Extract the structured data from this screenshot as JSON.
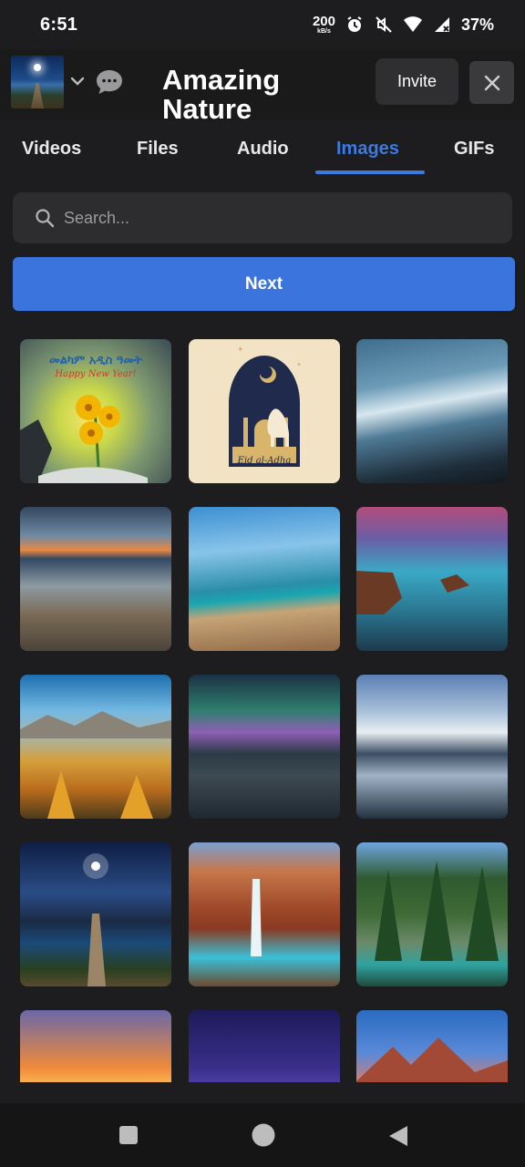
{
  "status_bar": {
    "time": "6:51",
    "net_speed": "200",
    "net_unit": "kB/s",
    "battery": "37%"
  },
  "header": {
    "title": "Amazing Nature",
    "invite_label": "Invite"
  },
  "tabs": [
    {
      "label": "Videos",
      "active": false
    },
    {
      "label": "Files",
      "active": false
    },
    {
      "label": "Audio",
      "active": false
    },
    {
      "label": "Images",
      "active": true
    },
    {
      "label": "GIFs",
      "active": false
    }
  ],
  "search": {
    "placeholder": "Search...",
    "value": ""
  },
  "next_button": "Next",
  "tile_texts": {
    "new_year_line1": "መልካም አዲስ ዓመት",
    "new_year_line2": "Happy New Year!",
    "eid": "Eid al-Adha"
  },
  "colors": {
    "accent": "#3b7ae0",
    "background": "#1d1d1f"
  }
}
